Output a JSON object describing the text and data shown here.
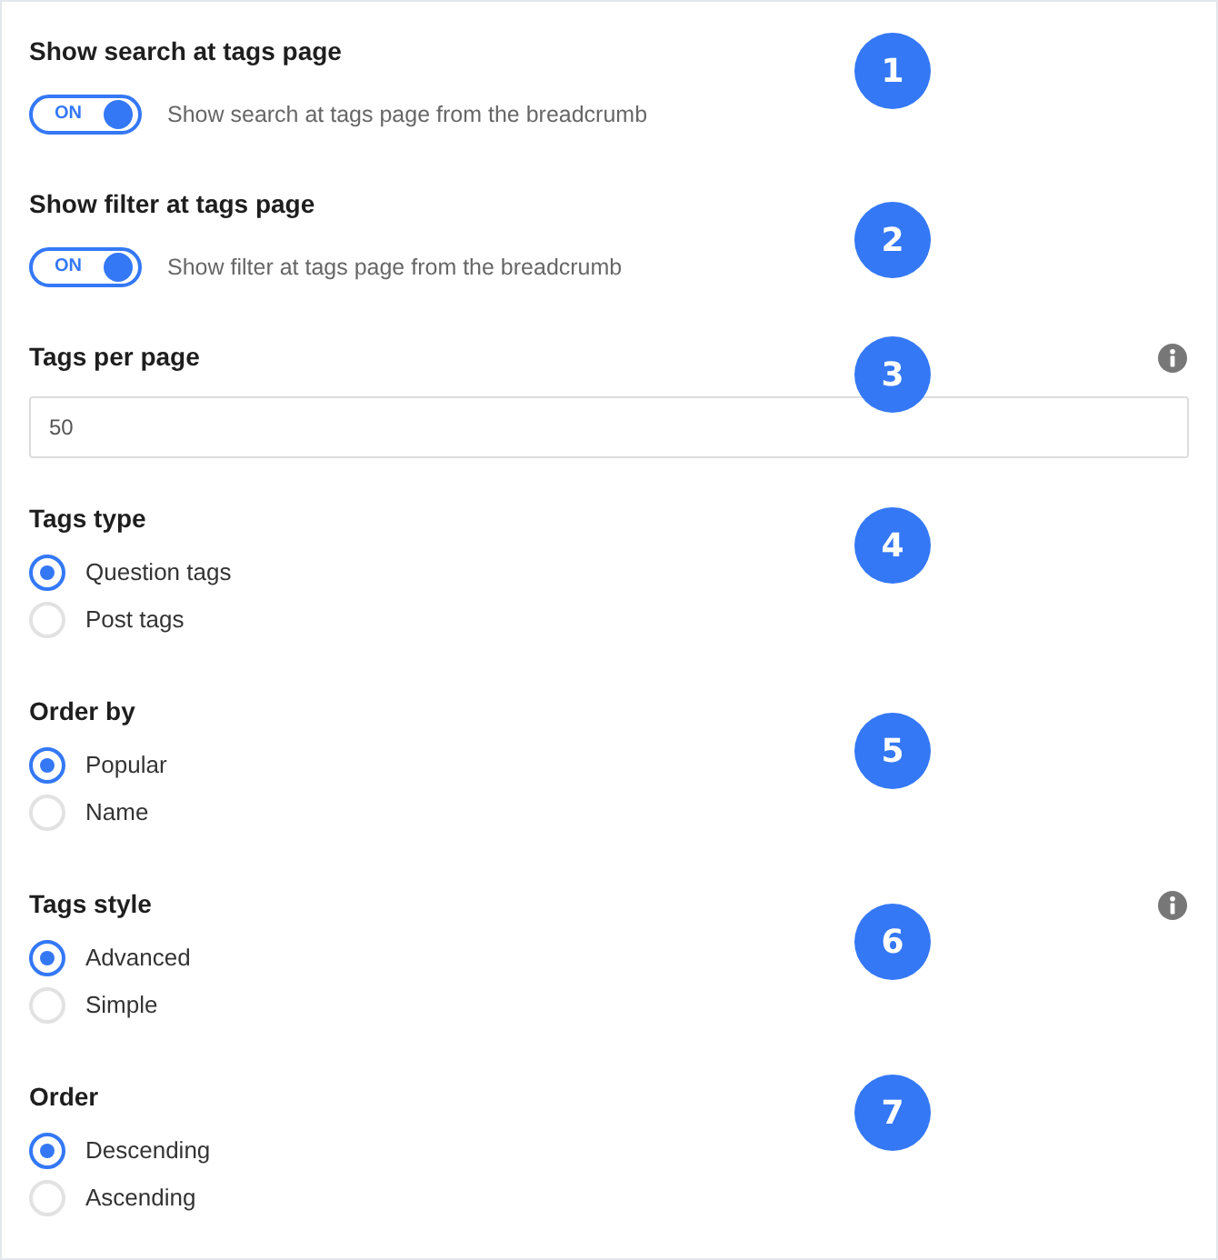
{
  "settings": [
    {
      "kind": "toggle",
      "title": "Show search at tags page",
      "info": false,
      "toggle": {
        "label": "ON",
        "on": true
      },
      "description": "Show search at tags page from the breadcrumb",
      "callout": "1"
    },
    {
      "kind": "toggle",
      "title": "Show filter at tags page",
      "info": false,
      "toggle": {
        "label": "ON",
        "on": true
      },
      "description": "Show filter at tags page from the breadcrumb",
      "callout": "2"
    },
    {
      "kind": "number",
      "title": "Tags per page",
      "info": true,
      "value": "50",
      "callout": "3"
    },
    {
      "kind": "radio",
      "title": "Tags type",
      "info": false,
      "options": [
        {
          "label": "Question tags",
          "selected": true
        },
        {
          "label": "Post tags",
          "selected": false
        }
      ],
      "callout": "4"
    },
    {
      "kind": "radio",
      "title": "Order by",
      "info": false,
      "options": [
        {
          "label": "Popular",
          "selected": true
        },
        {
          "label": "Name",
          "selected": false
        }
      ],
      "callout": "5"
    },
    {
      "kind": "radio",
      "title": "Tags style",
      "info": true,
      "options": [
        {
          "label": "Advanced",
          "selected": true
        },
        {
          "label": "Simple",
          "selected": false
        }
      ],
      "callout": "6"
    },
    {
      "kind": "radio",
      "title": "Order",
      "info": false,
      "options": [
        {
          "label": "Descending",
          "selected": true
        },
        {
          "label": "Ascending",
          "selected": false
        }
      ],
      "callout": "7"
    }
  ]
}
